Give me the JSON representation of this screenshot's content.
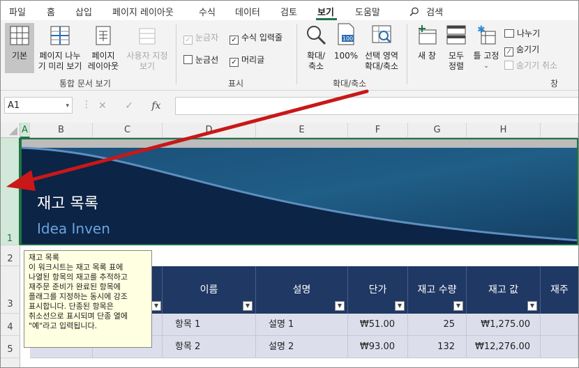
{
  "menu": {
    "items": [
      "파일",
      "홈",
      "삽입",
      "페이지 레이아웃",
      "수식",
      "데이터",
      "검토",
      "보기",
      "도움말"
    ],
    "active": "보기",
    "search_label": "검색"
  },
  "ribbon": {
    "workbook_views": {
      "buttons": [
        "기본",
        "페이지 나누기 미리 보기",
        "페이지 레이아웃",
        "사용자 지정 보기"
      ],
      "normal": "기본",
      "page_break_1": "페이지 나누",
      "page_break_2": "기 미리 보기",
      "page_layout_1": "페이지",
      "page_layout_2": "레이아웃",
      "custom_1": "사용자 지정",
      "custom_2": "보기",
      "group_label": "통합 문서 보기"
    },
    "show": {
      "ruler": "눈금자",
      "formula_bar": "수식 입력줄",
      "gridlines": "눈금선",
      "headings": "머리글",
      "group_label": "표시"
    },
    "zoom": {
      "zoom_1": "확대/",
      "zoom_2": "축소",
      "hundred": "100%",
      "hundred_icon_text": "100",
      "selection_1": "선택 영역",
      "selection_2": "확대/축소",
      "group_label": "확대/축소"
    },
    "window": {
      "new_window": "새 창",
      "arrange_1": "모두",
      "arrange_2": "정렬",
      "freeze": "틀 고정",
      "split": "나누기",
      "hide": "숨기기",
      "unhide": "숨기기 취소",
      "group_label": "창"
    }
  },
  "formula_bar": {
    "name_box": "A1",
    "cancel": "✕",
    "enter": "✓",
    "fx": "fx"
  },
  "columns": [
    "A",
    "B",
    "C",
    "D",
    "E",
    "F",
    "G",
    "H"
  ],
  "rows": [
    "1",
    "2",
    "3",
    "4",
    "5"
  ],
  "banner": {
    "title": "재고 목록",
    "subtitle": "Idea Inven"
  },
  "table": {
    "headers": [
      "",
      "",
      "이름",
      "설명",
      "단가",
      "재고 수량",
      "재고 값",
      "재주"
    ],
    "rows": [
      [
        "",
        "",
        "항목 1",
        "설명 1",
        "₩51.00",
        "25",
        "₩1,275.00",
        ""
      ],
      [
        "",
        "",
        "항목 2",
        "설명 2",
        "₩93.00",
        "132",
        "₩12,276.00",
        ""
      ]
    ]
  },
  "tooltip": {
    "title": "재고 목록",
    "lines": [
      "이 워크시트는 재고 목록 표에",
      "나열된 항목의 재고를 추적하고",
      "재주문 준비가 완료된 항목에",
      "플래그를 지정하는 동시에 강조",
      "표시합니다. 단종된 항목은",
      "취소선으로 표시되며 단종 열에",
      "\"예\"라고 입력됩니다."
    ]
  },
  "colors": {
    "accent": "#217346",
    "table_header": "#1f3864",
    "banded_row": "#dcdfeb",
    "arrow": "#e02020"
  }
}
